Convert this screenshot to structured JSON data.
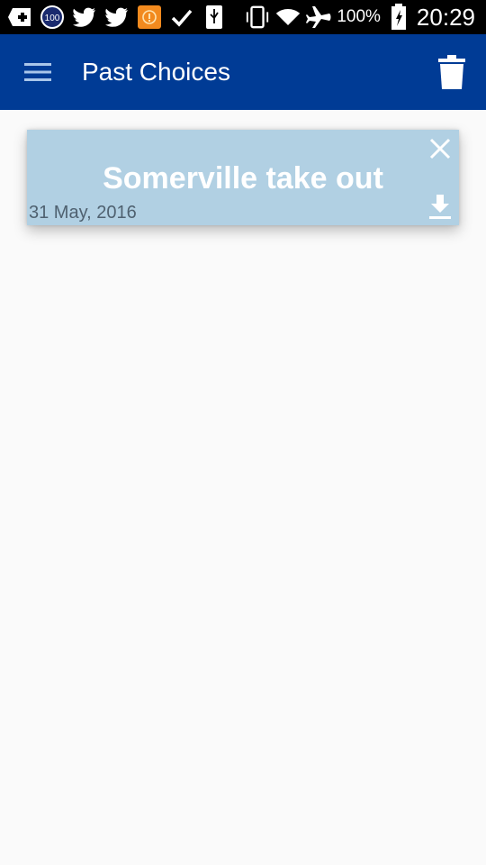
{
  "status_bar": {
    "battery_percent": "100%",
    "time": "20:29",
    "badge_number": "100",
    "icons": [
      "plus-box-icon",
      "badge-100-icon",
      "twitter-icon",
      "twitter-icon",
      "info-app-icon",
      "check-icon",
      "usb-icon",
      "vibrate-icon",
      "wifi-icon",
      "airplane-icon",
      "battery-charging-icon"
    ]
  },
  "appbar": {
    "title": "Past Choices",
    "menu_icon": "hamburger-menu-icon",
    "delete_icon": "trash-icon",
    "color": "#003b95"
  },
  "past_choices": [
    {
      "title": "Somerville take out",
      "date": "31 May, 2016",
      "close_icon": "close-icon",
      "download_icon": "download-icon",
      "color": "#b1d0e3"
    }
  ]
}
